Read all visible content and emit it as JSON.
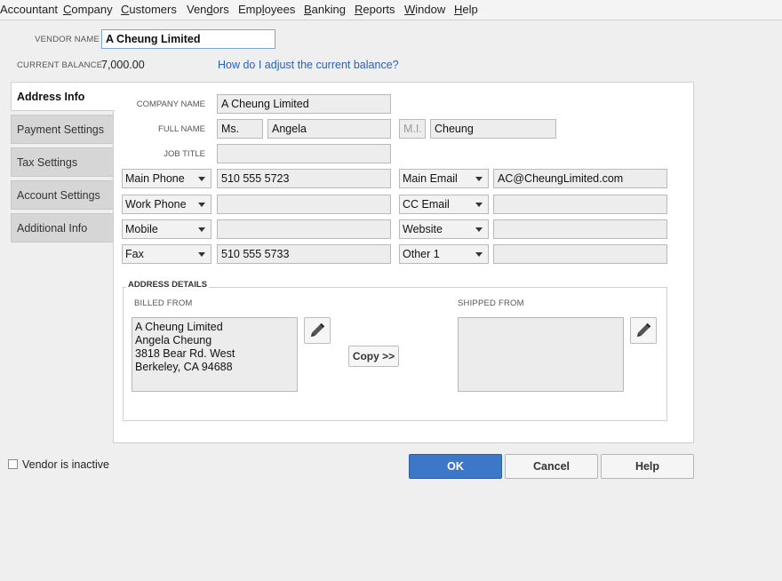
{
  "menu": [
    {
      "pre": "",
      "u": "",
      "post": "Accountant"
    },
    {
      "pre": "",
      "u": "C",
      "post": "ompany"
    },
    {
      "pre": "",
      "u": "C",
      "post": "ustomers"
    },
    {
      "pre": "Ven",
      "u": "d",
      "post": "ors"
    },
    {
      "pre": "Emp",
      "u": "l",
      "post": "oyees"
    },
    {
      "pre": "",
      "u": "B",
      "post": "anking"
    },
    {
      "pre": "",
      "u": "R",
      "post": "eports"
    },
    {
      "pre": "",
      "u": "W",
      "post": "indow"
    },
    {
      "pre": "",
      "u": "H",
      "post": "elp"
    }
  ],
  "vendor": {
    "name_label": "VENDOR NAME",
    "name_value": "A Cheung Limited",
    "balance_label": "CURRENT BALANCE",
    "balance_value": "7,000.00",
    "adjust_link": "How do I adjust the current balance?"
  },
  "tabs": [
    "Address Info",
    "Payment Settings",
    "Tax Settings",
    "Account Settings",
    "Additional Info"
  ],
  "address_info": {
    "company_label": "COMPANY NAME",
    "company_value": "A Cheung Limited",
    "fullname_label": "FULL NAME",
    "salutation": "Ms.",
    "first_name": "Angela",
    "mi_placeholder": "M.I.",
    "last_name": "Cheung",
    "jobtitle_label": "JOB TITLE",
    "jobtitle_value": "",
    "phones": [
      {
        "type": "Main Phone",
        "value": "510 555 5723"
      },
      {
        "type": "Work Phone",
        "value": ""
      },
      {
        "type": "Mobile",
        "value": ""
      },
      {
        "type": "Fax",
        "value": "510 555 5733"
      }
    ],
    "contacts": [
      {
        "type": "Main Email",
        "value": "AC@CheungLimited.com"
      },
      {
        "type": "CC Email",
        "value": ""
      },
      {
        "type": "Website",
        "value": ""
      },
      {
        "type": "Other 1",
        "value": ""
      }
    ]
  },
  "address_details": {
    "title": "ADDRESS DETAILS",
    "billed_label": "BILLED FROM",
    "billed_lines": [
      "A Cheung Limited",
      "Angela Cheung",
      "3818 Bear Rd. West",
      "Berkeley, CA 94688"
    ],
    "shipped_label": "SHIPPED FROM",
    "copy_label": "Copy >>"
  },
  "footer": {
    "inactive_label": "Vendor is inactive",
    "ok_label": "OK",
    "cancel_label": "Cancel",
    "help_label": "Help"
  },
  "icons": {
    "edit": "pencil-icon",
    "dropdown": "chevron-down-icon"
  },
  "colors": {
    "accent": "#3d78c8",
    "link": "#2a62b8",
    "focus_border": "#7aa6d6"
  }
}
